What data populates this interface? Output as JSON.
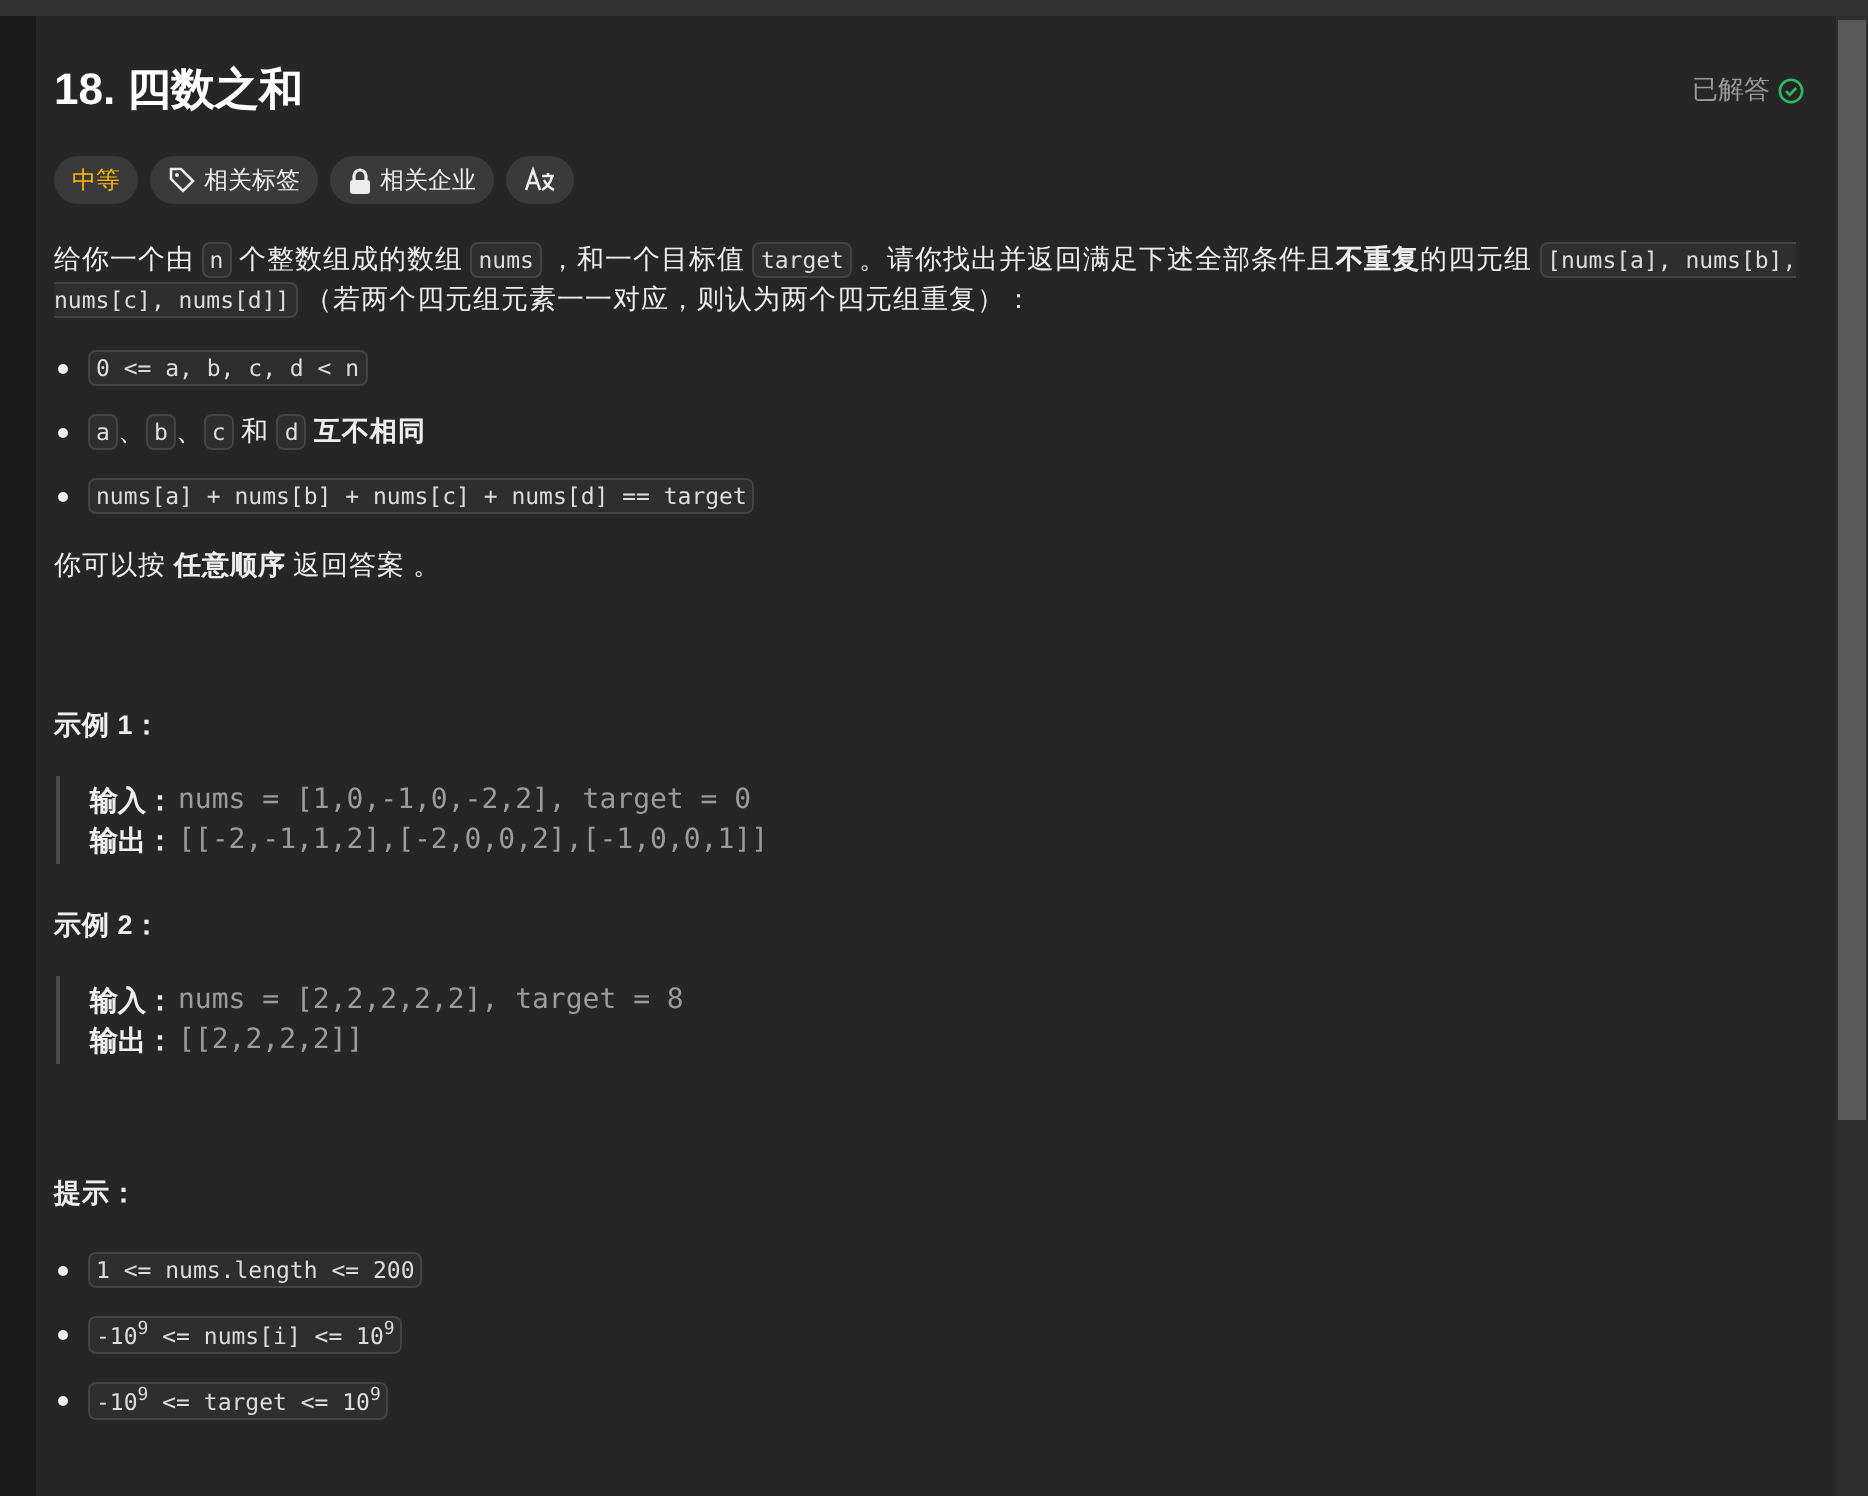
{
  "title": "18. 四数之和",
  "status": {
    "label": "已解答",
    "solved": true
  },
  "tags": [
    {
      "kind": "difficulty",
      "label": "中等",
      "color": "#ffb800"
    },
    {
      "kind": "tag",
      "label": "相关标签"
    },
    {
      "kind": "lock",
      "label": "相关企业"
    },
    {
      "kind": "translate"
    }
  ],
  "description": [
    {
      "kind": "text",
      "text": "给你一个由 "
    },
    {
      "kind": "code",
      "text": "n"
    },
    {
      "kind": "text",
      "text": " 个整数组成的数组 "
    },
    {
      "kind": "code",
      "text": "nums"
    },
    {
      "kind": "text",
      "text": " ，和一个目标值 "
    },
    {
      "kind": "code",
      "text": "target"
    },
    {
      "kind": "text",
      "text": " 。请你找出并返回满足下述全部条件且**不重复**的四元组 "
    },
    {
      "kind": "code",
      "text": "[nums[a], nums[b], nums[c], nums[d]]"
    },
    {
      "kind": "text",
      "text": " （若两个四元组元素一一对应，则认为两个四元组重复）："
    }
  ],
  "conditions": [
    [
      {
        "kind": "code",
        "text": "0 <= a, b, c, d < n"
      }
    ],
    [
      {
        "kind": "code",
        "text": "a"
      },
      {
        "kind": "text",
        "text": "、"
      },
      {
        "kind": "code",
        "text": "b"
      },
      {
        "kind": "text",
        "text": "、"
      },
      {
        "kind": "code",
        "text": "c"
      },
      {
        "kind": "text",
        "text": " 和 "
      },
      {
        "kind": "code",
        "text": "d"
      },
      {
        "kind": "text",
        "text": " **互不相同**"
      }
    ],
    [
      {
        "kind": "code",
        "text": "nums[a] + nums[b] + nums[c] + nums[d] == target"
      }
    ]
  ],
  "notice": "你可以按 **任意顺序** 返回答案 。",
  "examples": [
    {
      "title": "示例 1：",
      "lines": [
        {
          "label": "输入：",
          "value": "nums = [1,0,-1,0,-2,2], target = 0"
        },
        {
          "label": "输出：",
          "value": "[[-2,-1,1,2],[-2,0,0,2],[-1,0,0,1]]"
        }
      ]
    },
    {
      "title": "示例 2：",
      "lines": [
        {
          "label": "输入：",
          "value": "nums = [2,2,2,2,2], target = 8"
        },
        {
          "label": "输出：",
          "value": "[[2,2,2,2]]"
        }
      ]
    }
  ],
  "hints": {
    "title": "提示：",
    "items": [
      "1 <= nums.length <= 200",
      "-10$^{9}$ <= nums[i] <= 10$^{9}$",
      "-10$^{9}$ <= target <= 10$^{9}$"
    ]
  }
}
